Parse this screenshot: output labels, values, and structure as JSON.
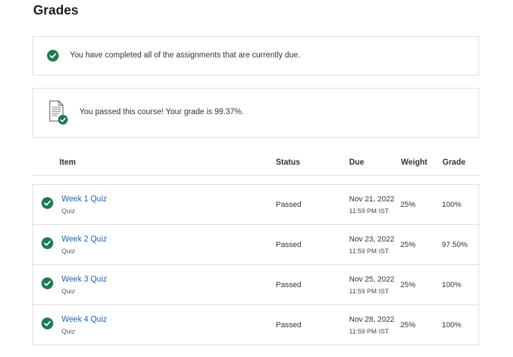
{
  "page": {
    "title": "Grades"
  },
  "notices": {
    "due": {
      "text": "You have completed all of the assignments that are currently due.",
      "icon": "check-circle-icon"
    },
    "pass": {
      "text": "You passed this course! Your grade is 99.37%.",
      "icon": "document-check-icon"
    }
  },
  "colors": {
    "success": "#1f7a4f",
    "link": "#1f5fb0",
    "border": "#dcdcdc"
  },
  "table": {
    "headers": {
      "item": "Item",
      "status": "Status",
      "due": "Due",
      "weight": "Weight",
      "grade": "Grade"
    },
    "rows": [
      {
        "title": "Week 1 Quiz",
        "type": "Quiz",
        "status": "Passed",
        "due_date": "Nov 21, 2022",
        "due_time": "11:59 PM IST",
        "weight": "25%",
        "grade": "100%"
      },
      {
        "title": "Week 2 Quiz",
        "type": "Quiz",
        "status": "Passed",
        "due_date": "Nov 23, 2022",
        "due_time": "11:59 PM IST",
        "weight": "25%",
        "grade": "97.50%"
      },
      {
        "title": "Week 3 Quiz",
        "type": "Quiz",
        "status": "Passed",
        "due_date": "Nov 25, 2022",
        "due_time": "11:59 PM IST",
        "weight": "25%",
        "grade": "100%"
      },
      {
        "title": "Week 4 Quiz",
        "type": "Quiz",
        "status": "Passed",
        "due_date": "Nov 28, 2022",
        "due_time": "11:59 PM IST",
        "weight": "25%",
        "grade": "100%"
      }
    ]
  }
}
